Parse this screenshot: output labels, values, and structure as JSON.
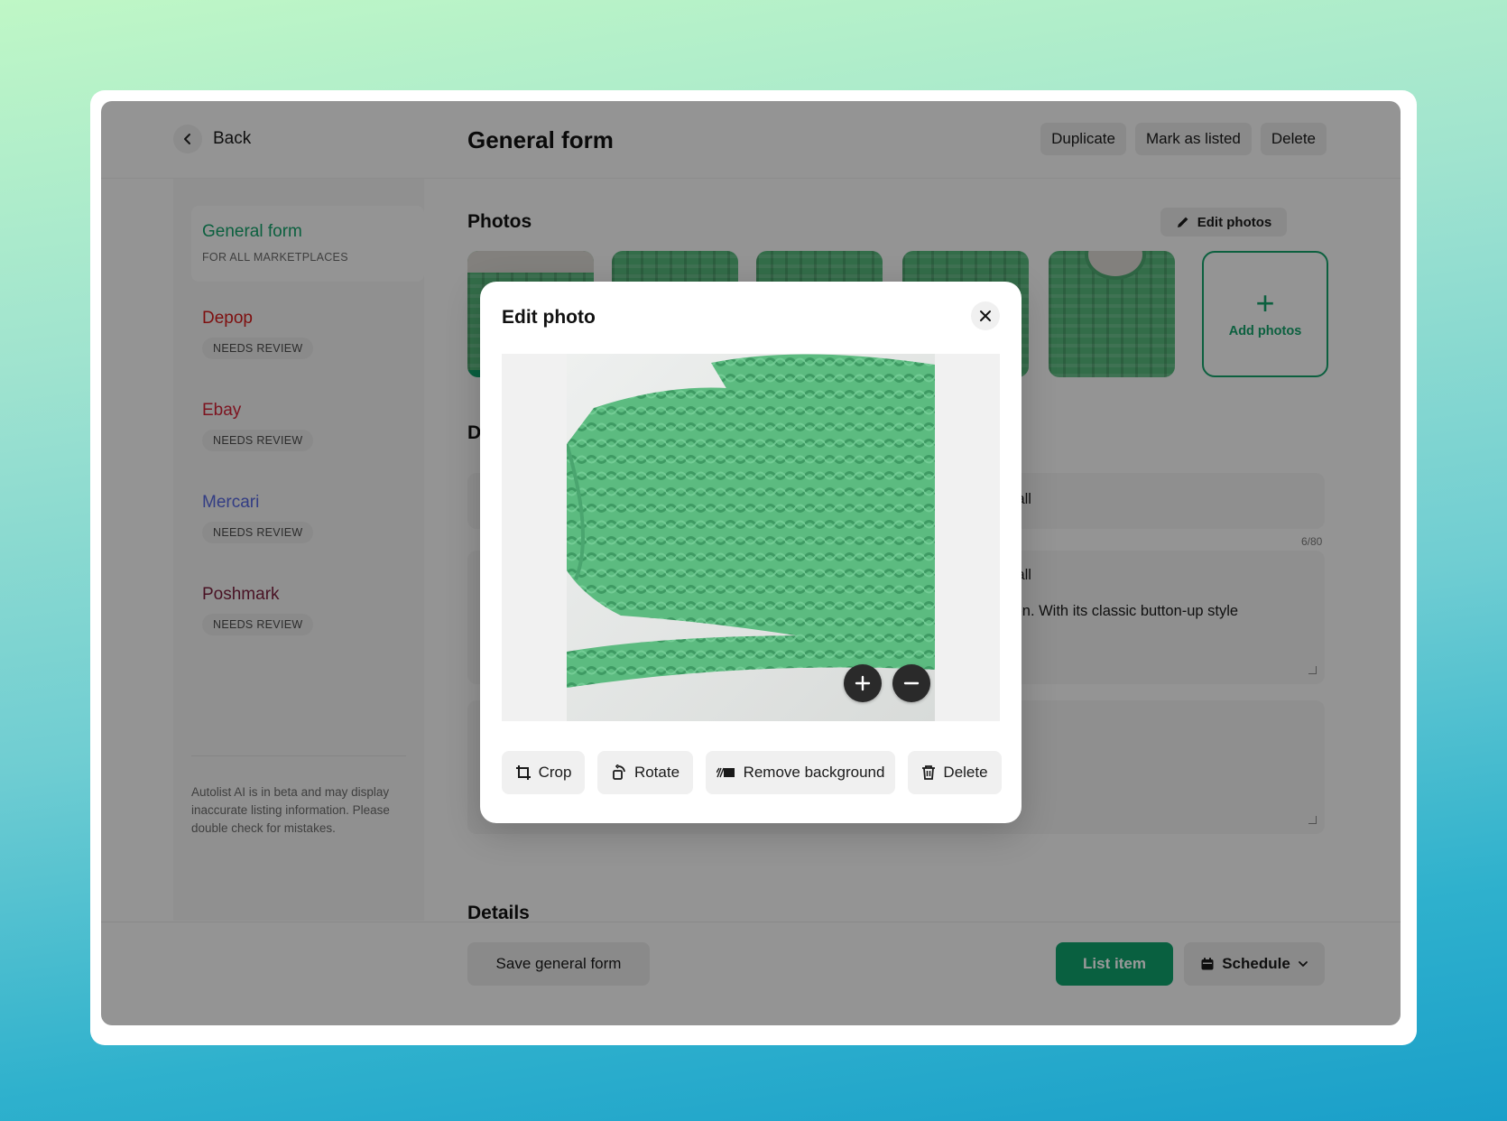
{
  "header": {
    "back_label": "Back",
    "title": "General form",
    "actions": [
      "Duplicate",
      "Mark as listed",
      "Delete"
    ]
  },
  "sidebar": {
    "items": [
      {
        "name": "General form",
        "sub": "FOR ALL MARKETPLACES",
        "color": "#14a06a"
      },
      {
        "name": "Depop",
        "badge": "NEEDS REVIEW",
        "color": "#d21c1c"
      },
      {
        "name": "Ebay",
        "badge": "NEEDS REVIEW",
        "color": "#d12236"
      },
      {
        "name": "Mercari",
        "badge": "NEEDS REVIEW",
        "color": "#5566dd"
      },
      {
        "name": "Poshmark",
        "badge": "NEEDS REVIEW",
        "color": "#7a1f3d"
      }
    ],
    "note": "Autolist AI is in beta and may display inaccurate listing information. Please double check for mistakes."
  },
  "main": {
    "photos_title": "Photos",
    "edit_photos_label": "Edit photos",
    "add_photos_label": "Add photos",
    "description_title_partial": "D",
    "title_field_visible": "um Tall",
    "title_counter": "6/80",
    "desc_line1_visible": "um Tall",
    "desc_line2_visible": "ccasion. With its classic button-up style",
    "details_title": "Details"
  },
  "footer": {
    "save_label": "Save general form",
    "list_label": "List item",
    "schedule_label": "Schedule"
  },
  "modal": {
    "title": "Edit photo",
    "tools": [
      "Crop",
      "Rotate",
      "Remove background",
      "Delete"
    ]
  },
  "colors": {
    "accent": "#10a06c",
    "sweater": "#55b67a"
  }
}
